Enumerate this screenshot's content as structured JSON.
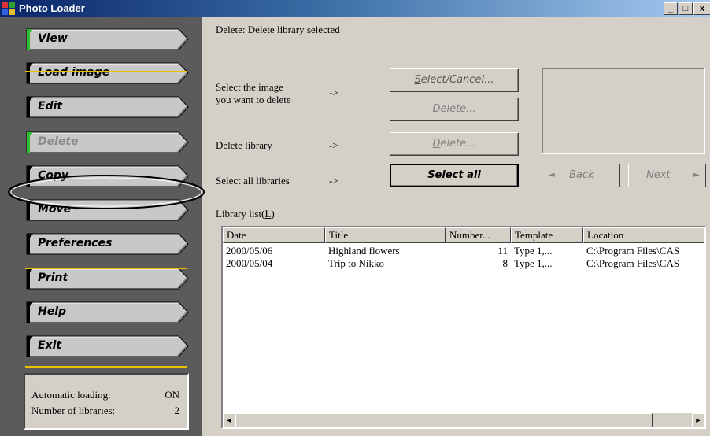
{
  "window": {
    "title": "Photo Loader",
    "controls": [
      "_",
      "□",
      "x"
    ]
  },
  "sidebar": {
    "buttons": [
      {
        "label": "View",
        "enabled": true,
        "icon": "green-indicator-icon"
      },
      {
        "label": "Load image",
        "enabled": true
      },
      {
        "label": "Edit",
        "enabled": true
      },
      {
        "label": "Delete",
        "enabled": false,
        "selected": true
      },
      {
        "label": "Copy",
        "enabled": true
      },
      {
        "label": "Move",
        "enabled": true
      },
      {
        "label": "Preferences",
        "enabled": true
      },
      {
        "label": "Print",
        "enabled": true
      },
      {
        "label": "Help",
        "enabled": true
      },
      {
        "label": "Exit",
        "enabled": true
      }
    ],
    "status": {
      "auto_label": "Automatic loading:",
      "auto_value": "ON",
      "libs_label": "Number of libraries:",
      "libs_value": "2"
    }
  },
  "main": {
    "status_line": "Delete: Delete library selected",
    "select_image_line1": "Select the image",
    "select_image_line2": "you want to delete",
    "arrow": "->",
    "delete_library_label": "Delete library",
    "select_all_libraries_label": "Select all libraries",
    "buttons": {
      "select_cancel": {
        "pre": "",
        "key": "S",
        "post": "elect/Cancel..."
      },
      "delete_image": {
        "pre": "D",
        "key": "e",
        "post": "lete..."
      },
      "delete_library": {
        "pre": "",
        "key": "D",
        "post": "elete..."
      },
      "select_all": {
        "pre": "Select ",
        "key": "a",
        "post": "ll"
      },
      "back": {
        "arrow": "◄",
        "pre": "",
        "key": "B",
        "post": "ack"
      },
      "next": {
        "pre": "",
        "key": "N",
        "post": "ext",
        "arrow": "►"
      }
    },
    "library_list_label_pre": "Library list(",
    "library_list_label_key": "L",
    "library_list_label_post": ")",
    "columns": [
      "Date",
      "Title",
      "Number...",
      "Template",
      "Location"
    ],
    "rows": [
      {
        "date": "2000/05/06",
        "title": "Highland flowers",
        "number": "11",
        "template": "Type 1,...",
        "location": "C:\\Program Files\\CAS"
      },
      {
        "date": "2000/05/04",
        "title": "Trip to Nikko",
        "number": "8",
        "template": "Type 1,...",
        "location": "C:\\Program Files\\CAS"
      }
    ]
  },
  "colors": {
    "sidebar_bg": "#5b5b5b",
    "accent_yellow": "#e8c000",
    "title_gradient_start": "#0a246a"
  }
}
